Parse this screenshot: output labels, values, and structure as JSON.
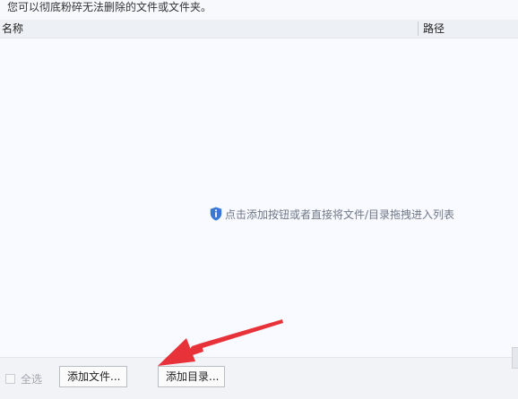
{
  "description": "您可以彻底粉碎无法删除的文件或文件夹。",
  "list": {
    "columns": [
      "名称",
      "路径"
    ],
    "rows": [],
    "empty_hint": "点击添加按钮或者直接将文件/目录拖拽进入列表",
    "empty_hint_icon": "shield-info-icon"
  },
  "footer": {
    "select_all_label": "全选",
    "select_all_checked": false,
    "select_all_enabled": false,
    "add_file_label": "添加文件...",
    "add_dir_label": "添加目录..."
  },
  "colors": {
    "hint_icon": "#3a78d8",
    "annotation_arrow": "#e8323a",
    "list_background": "#f8faff",
    "header_background": "#edf0f4"
  }
}
